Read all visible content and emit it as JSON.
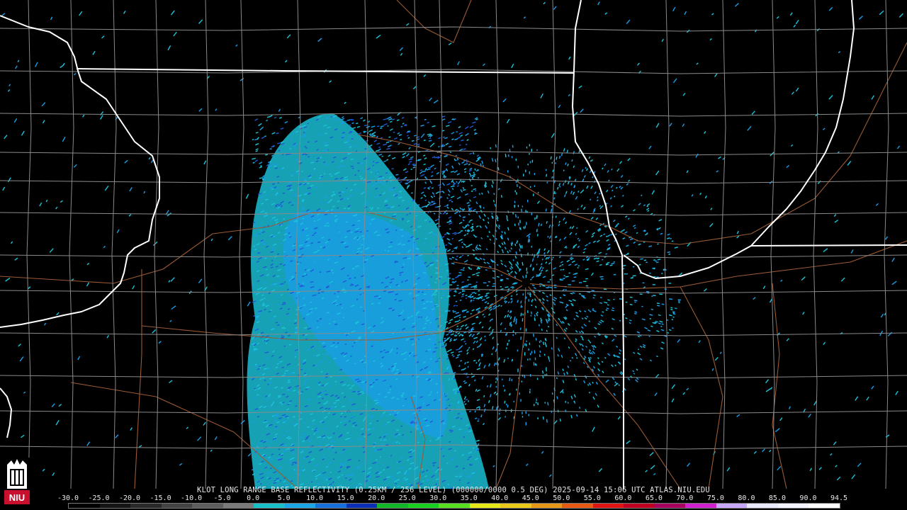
{
  "product": {
    "caption": "KLOT LONG RANGE BASE REFLECTIVITY (0.25KM / 256 LEVEL) (000000/0000 0.5 DEG) 2025-09-14 15:06 UTC  ATLAS.NIU.EDU"
  },
  "logo": {
    "text": "NIU"
  },
  "color_scale": {
    "labels": [
      "-30.0",
      "-25.0",
      "-20.0",
      "-15.0",
      "-10.0",
      "-5.0",
      "0.0",
      "5.0",
      "10.0",
      "15.0",
      "20.0",
      "25.0",
      "30.0",
      "35.0",
      "40.0",
      "45.0",
      "50.0",
      "55.0",
      "60.0",
      "65.0",
      "70.0",
      "75.0",
      "80.0",
      "85.0",
      "90.0",
      "94.5"
    ],
    "colors": [
      "#000000",
      "#151515",
      "#2a2a2a",
      "#444444",
      "#5e5e5e",
      "#7a7a7a",
      "#18bfc8",
      "#1aa6e6",
      "#1770e0",
      "#0c2fb8",
      "#10b828",
      "#18d020",
      "#58e020",
      "#e8e818",
      "#e8c818",
      "#e89818",
      "#e85a14",
      "#e01414",
      "#c00020",
      "#a80060",
      "#d020d0",
      "#c8a8ff",
      "#e8e8ff",
      "#f4f4ff",
      "#ffffff"
    ]
  },
  "colors": {
    "boundary_state": "#ffffff",
    "boundary_county": "#8a8a8a",
    "road": "#9a5a34",
    "echo_light": "#1cc4dc",
    "echo_mid": "#1a9ee8",
    "echo_dark": "#1f5ad8"
  }
}
